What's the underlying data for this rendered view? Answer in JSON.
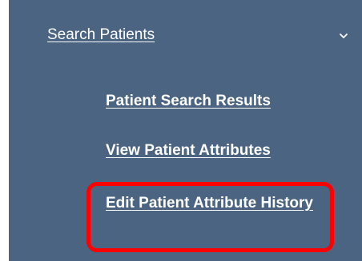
{
  "menu": {
    "header_label": "Search Patients",
    "header_icon": "chevron-down-icon",
    "items": [
      {
        "label": "Patient Search Results"
      },
      {
        "label": "View Patient Attributes"
      },
      {
        "label": "Edit Patient Attribute History"
      }
    ]
  },
  "highlight": {
    "target": "Edit Patient Attribute History",
    "color": "#ff0000"
  },
  "colors": {
    "panel_background": "#4a6481",
    "text": "#ffffff"
  }
}
